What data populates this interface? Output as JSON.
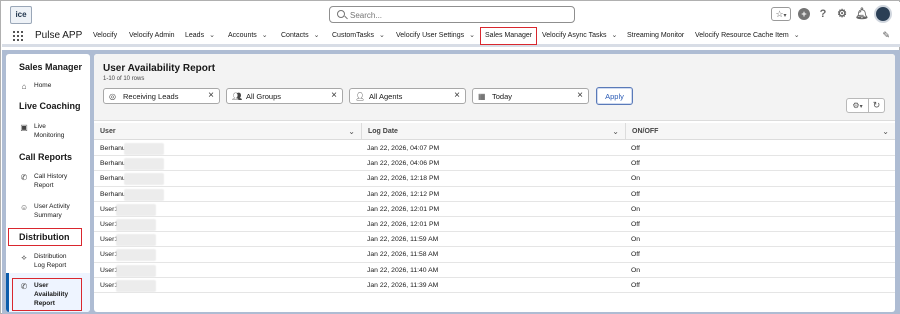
{
  "header": {
    "logo_text": "ice",
    "search_placeholder": "Search...",
    "star_icon": "☆",
    "icons": [
      "plus-icon",
      "help-icon",
      "gear-icon",
      "bell-icon",
      "avatar"
    ]
  },
  "nav": {
    "app_name": "Pulse APP",
    "items": [
      {
        "label": "Velocify",
        "chevron": false
      },
      {
        "label": "Velocify Admin",
        "chevron": false
      },
      {
        "label": "Leads",
        "chevron": true
      },
      {
        "label": "Accounts",
        "chevron": true
      },
      {
        "label": "Contacts",
        "chevron": true
      },
      {
        "label": "CustomTasks",
        "chevron": true
      },
      {
        "label": "Velocify User Settings",
        "chevron": true
      },
      {
        "label": "Sales Manager",
        "chevron": false,
        "active": true
      },
      {
        "label": "Velocify Async Tasks",
        "chevron": true
      },
      {
        "label": "Streaming Monitor",
        "chevron": false
      },
      {
        "label": "Velocify Resource Cache Item",
        "chevron": true
      }
    ]
  },
  "sidebar": {
    "title": "Sales Manager",
    "home": "Home",
    "sections": [
      {
        "title": "Live Coaching",
        "items": [
          "Live Monitoring"
        ]
      },
      {
        "title": "Call Reports",
        "items": [
          "Call History Report",
          "User Activity Summary"
        ]
      },
      {
        "title": "Distribution",
        "items": [
          "Distribution Log Report",
          "User Availability Report"
        ]
      }
    ]
  },
  "report": {
    "title": "User Availability Report",
    "subtitle": "1-10 of 10 rows",
    "filters": {
      "campaign": "Receiving Leads",
      "group": "All Groups",
      "agent": "All Agents",
      "date": "Today"
    },
    "apply_label": "Apply",
    "columns": [
      "User",
      "Log Date",
      "ON/OFF"
    ],
    "rows": [
      {
        "user": "Berhanu",
        "log_date": "Jan 22, 2026, 04:07 PM",
        "status": "Off"
      },
      {
        "user": "Berhanu",
        "log_date": "Jan 22, 2026, 04:06 PM",
        "status": "Off"
      },
      {
        "user": "Berhanu",
        "log_date": "Jan 22, 2026, 12:18 PM",
        "status": "On"
      },
      {
        "user": "Berhanu",
        "log_date": "Jan 22, 2026, 12:12 PM",
        "status": "Off"
      },
      {
        "user": "User1",
        "log_date": "Jan 22, 2026, 12:01 PM",
        "status": "On"
      },
      {
        "user": "User1",
        "log_date": "Jan 22, 2026, 12:01 PM",
        "status": "Off"
      },
      {
        "user": "User1",
        "log_date": "Jan 22, 2026, 11:59 AM",
        "status": "On"
      },
      {
        "user": "User1",
        "log_date": "Jan 22, 2026, 11:58 AM",
        "status": "Off"
      },
      {
        "user": "User1",
        "log_date": "Jan 22, 2026, 11:40 AM",
        "status": "On"
      },
      {
        "user": "User1",
        "log_date": "Jan 22, 2026, 11:39 AM",
        "status": "Off"
      }
    ]
  },
  "colors": {
    "accent": "#0b5cab",
    "highlight": "#d9272e",
    "page_bg": "#aebcd3"
  }
}
